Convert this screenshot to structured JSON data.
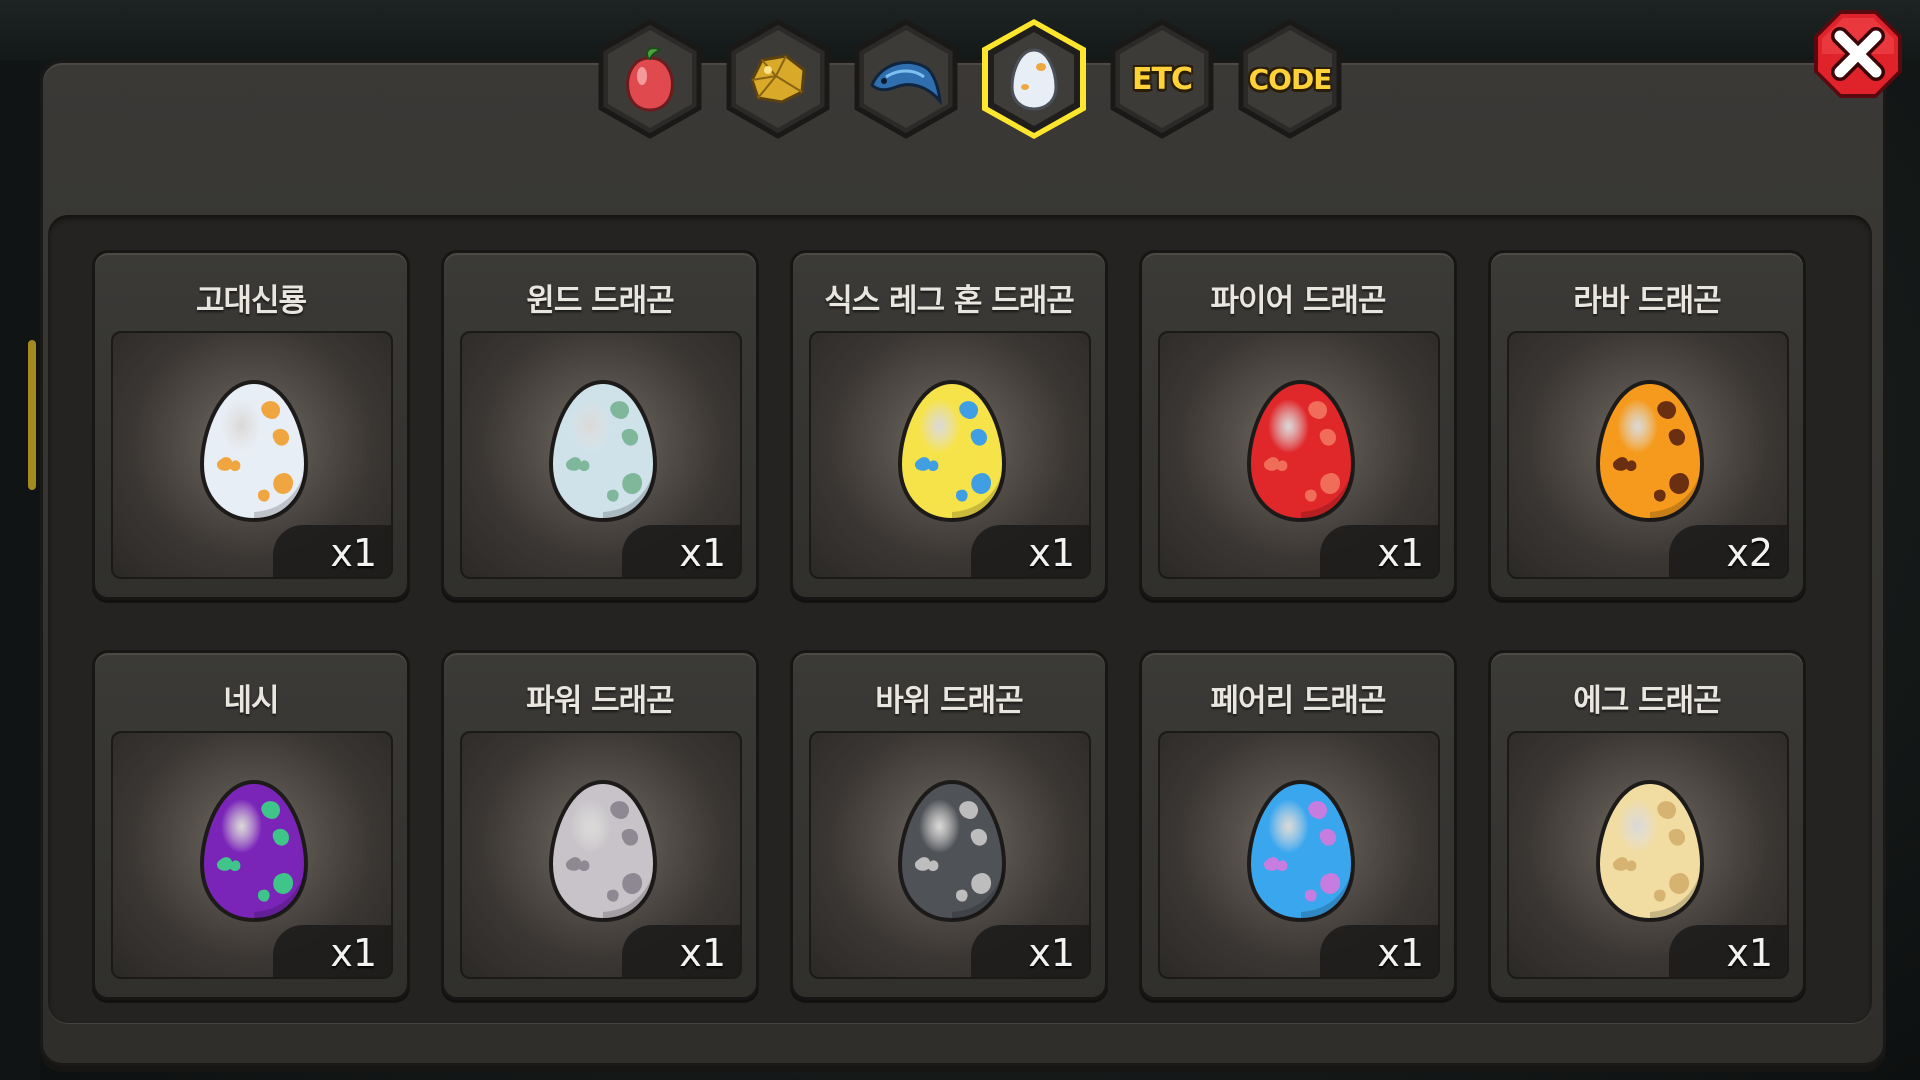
{
  "tabs": [
    {
      "id": "fruit",
      "icon": "red-fruit-icon"
    },
    {
      "id": "ore",
      "icon": "gold-ore-icon"
    },
    {
      "id": "fish",
      "icon": "blue-fish-icon"
    },
    {
      "id": "egg",
      "icon": "egg-icon",
      "active": true
    },
    {
      "id": "etc",
      "label": "ETC"
    },
    {
      "id": "code",
      "label": "CODE"
    }
  ],
  "colors": {
    "active_tab_glow": "#ffe62e",
    "tab_text": "#ffd23a",
    "close_red": "#e0232b"
  },
  "items": [
    {
      "name": "고대신룡",
      "count": "x1",
      "base": "#e8eef6",
      "spot": "#f0a640"
    },
    {
      "name": "윈드 드래곤",
      "count": "x1",
      "base": "#cfe2ea",
      "spot": "#7fb79b"
    },
    {
      "name": "식스 레그 혼 드래곤",
      "count": "x1",
      "base": "#f6e34a",
      "spot": "#3f9fe2"
    },
    {
      "name": "파이어 드래곤",
      "count": "x1",
      "base": "#e0282b",
      "spot": "#f06d5a"
    },
    {
      "name": "라바 드래곤",
      "count": "x2",
      "base": "#f59a1c",
      "spot": "#6a2e10"
    },
    {
      "name": "네시",
      "count": "x1",
      "base": "#7a25b8",
      "spot": "#3fc48a"
    },
    {
      "name": "파워 드래곤",
      "count": "x1",
      "base": "#c7c3c8",
      "spot": "#8d8892"
    },
    {
      "name": "바위 드래곤",
      "count": "x1",
      "base": "#4f5257",
      "spot": "#bdbdbd"
    },
    {
      "name": "페어리 드래곤",
      "count": "x1",
      "base": "#3aa6ee",
      "spot": "#c77de0"
    },
    {
      "name": "에그 드래곤",
      "count": "x1",
      "base": "#f1dca2",
      "spot": "#d6b370"
    }
  ]
}
